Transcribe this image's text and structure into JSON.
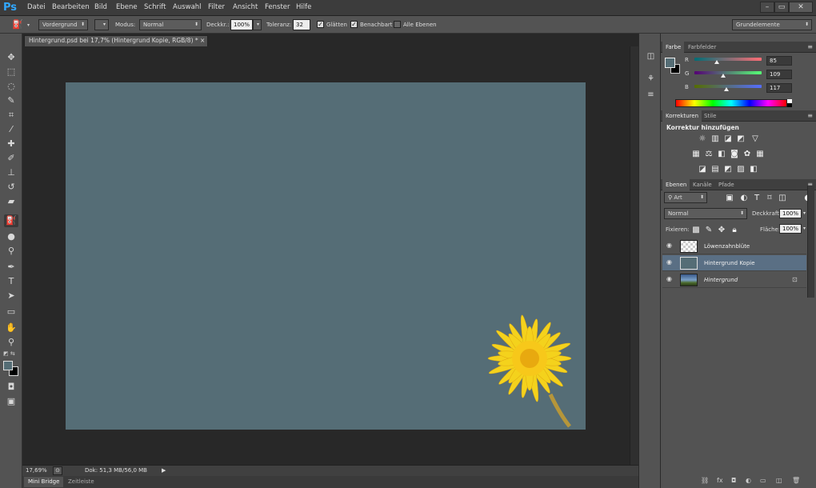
{
  "app": {
    "logo": "Ps"
  },
  "menu": [
    "Datei",
    "Bearbeiten",
    "Bild",
    "Ebene",
    "Schrift",
    "Auswahl",
    "Filter",
    "Ansicht",
    "Fenster",
    "Hilfe"
  ],
  "window_controls": {
    "minimize": "–",
    "restore": "▭",
    "close": "✕"
  },
  "options": {
    "tool_preset": "Vordergrund",
    "mode_label": "Modus:",
    "mode_value": "Normal",
    "opacity_label": "Deckkr.:",
    "opacity_value": "100%",
    "tolerance_label": "Toleranz:",
    "tolerance_value": "32",
    "antialias_label": "Glätten",
    "contiguous_label": "Benachbart",
    "all_layers_label": "Alle Ebenen",
    "workspace": "Grundelemente"
  },
  "document": {
    "tab_title": "Hintergrund.psd bei 17,7% (Hintergrund Kopie, RGB/8) *",
    "tab_close": "×",
    "canvas_color": "#556d76"
  },
  "status": {
    "zoom": "17,69%",
    "doc_info": "Dok: 51,3 MB/56,0 MB"
  },
  "bottom_tabs": [
    "Mini Bridge",
    "Zeitleiste"
  ],
  "color_panel": {
    "tabs": [
      "Farbe",
      "Farbfelder"
    ],
    "channels": [
      {
        "label": "R",
        "value": "85"
      },
      {
        "label": "G",
        "value": "109"
      },
      {
        "label": "B",
        "value": "117"
      }
    ],
    "foreground": "#556d75",
    "background": "#000000"
  },
  "adjustments_panel": {
    "tabs": [
      "Korrekturen",
      "Stile"
    ],
    "heading": "Korrektur hinzufügen"
  },
  "layers_panel": {
    "tabs": [
      "Ebenen",
      "Kanäle",
      "Pfade"
    ],
    "filter_kind": "Art",
    "blend_mode": "Normal",
    "opacity_label": "Deckkraft:",
    "opacity_value": "100%",
    "lock_label": "Fixieren:",
    "fill_label": "Fläche:",
    "fill_value": "100%",
    "layers": [
      {
        "name": "Löwenzahnblüte",
        "selected": false
      },
      {
        "name": "Hintergrund Kopie",
        "selected": true
      },
      {
        "name": "Hintergrund",
        "selected": false,
        "locked": true
      }
    ]
  }
}
